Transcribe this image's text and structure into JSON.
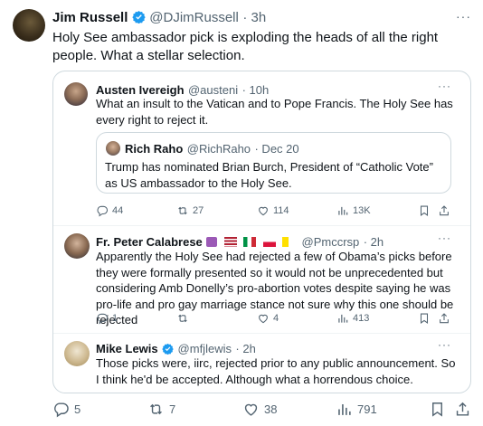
{
  "main_tweet": {
    "author_name": "Jim Russell",
    "handle": "@DJimRussell",
    "time": "· 3h",
    "text": "Holy See ambassador pick is exploding the heads of all the right people. What a stellar selection.",
    "more": "···",
    "metrics": {
      "replies": "5",
      "reposts": "7",
      "likes": "38",
      "views": "791"
    }
  },
  "quoted_tweet": {
    "author_name": "Austen Ivereigh",
    "handle": "@austeni",
    "time": "· 10h",
    "text": "What an insult to the Vatican and to Pope Francis. The Holy See has every right to reject it.",
    "more": "···",
    "metrics": {
      "replies": "44",
      "reposts": "27",
      "likes": "114",
      "views": "13K"
    },
    "inner_quote": {
      "author_name": "Rich Raho",
      "handle": "@RichRaho",
      "time": "· Dec 20",
      "text": "Trump has nominated Brian Burch, President of “Catholic Vote” as US ambassador to the Holy See."
    }
  },
  "reply_1": {
    "author_name": "Fr. Peter Calabrese",
    "handle": "@Pmccrsp",
    "time": "· 2h",
    "text": "Apparently the Holy See had rejected a few of Obama’s picks before they were formally presented so it would not be unprecedented but considering Amb Donelly’s pro-abortion votes despite saying he was pro-life and pro gay marriage stance not sure why this one should be rejected",
    "more": "···",
    "metrics": {
      "replies": "1",
      "reposts": "",
      "likes": "4",
      "views": "413"
    }
  },
  "reply_2": {
    "author_name": "Mike Lewis",
    "handle": "@mfjlewis",
    "time": "· 2h",
    "text": "Those picks were, iirc, rejected prior to any public announcement. So I think he'd be accepted. Although what a horrendous choice.",
    "more": "···"
  },
  "colors": {
    "verified": "#1d9bf0",
    "muted": "#536471",
    "border": "#cfd9de"
  }
}
